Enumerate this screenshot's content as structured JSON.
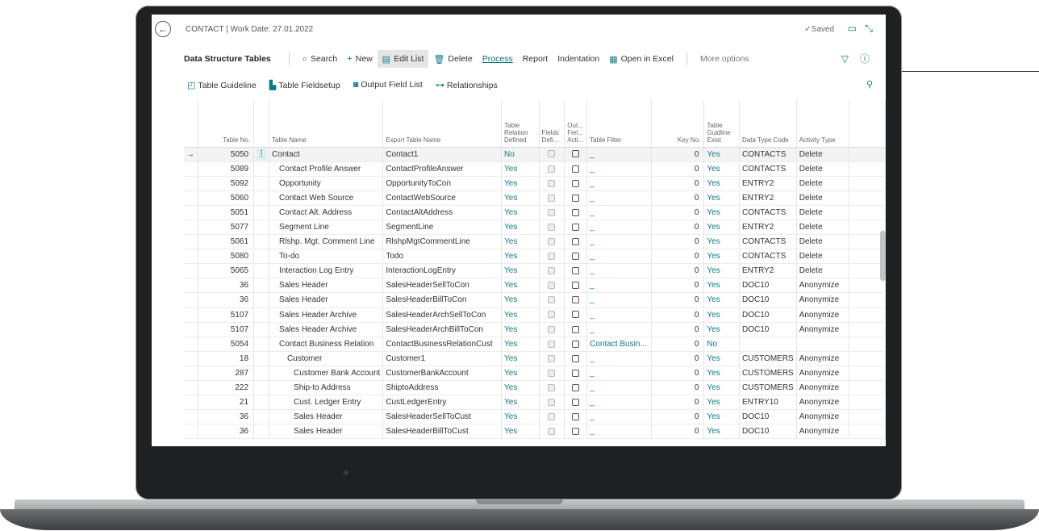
{
  "header": {
    "caption": "CONTACT | Work Date: 27.01.2022",
    "saved": "✓Saved",
    "back_icon": "←"
  },
  "action_bar": {
    "title": "Data Structure Tables",
    "search": "Search",
    "new": "New",
    "edit_list": "Edit List",
    "delete": "Delete",
    "process": "Process",
    "report": "Report",
    "indentation": "Indentation",
    "open_in_excel": "Open in Excel",
    "more_options": "More options"
  },
  "sub_bar": {
    "table_guideline": "Table Guideline",
    "table_fieldsetup": "Table Fieldsetup",
    "output_field_list": "Output Field List",
    "relationships": "Relationships"
  },
  "columns": {
    "table_no": "Table No.",
    "table_name": "Table Name",
    "export_table_name": "Export Table Name",
    "table_relation_defined": "Table Relation Defined",
    "fields_defined": "Fields Defi...",
    "output_fields_active": "Out... Fiel... Acti...",
    "table_filter": "Table Filter",
    "key_no": "Key No.",
    "table_guideline_exist": "Table Guidline Exist",
    "data_type_code": "Data Type Code",
    "activity_type": "Activity Type"
  },
  "rows": [
    {
      "no": "5050",
      "name": "Contact",
      "indent": 0,
      "export": "Contact1",
      "rel": "No",
      "filter": "_",
      "key": "0",
      "guide": "Yes",
      "dtype": "CONTACTS",
      "activity": "Delete"
    },
    {
      "no": "5089",
      "name": "Contact Profile Answer",
      "indent": 1,
      "export": "ContactProfileAnswer",
      "rel": "Yes",
      "filter": "_",
      "key": "0",
      "guide": "Yes",
      "dtype": "CONTACTS",
      "activity": "Delete"
    },
    {
      "no": "5092",
      "name": "Opportunity",
      "indent": 1,
      "export": "OpportunityToCon",
      "rel": "Yes",
      "filter": "_",
      "key": "0",
      "guide": "Yes",
      "dtype": "ENTRY2",
      "activity": "Delete"
    },
    {
      "no": "5060",
      "name": "Contact Web Source",
      "indent": 1,
      "export": "ContactWebSource",
      "rel": "Yes",
      "filter": "_",
      "key": "0",
      "guide": "Yes",
      "dtype": "ENTRY2",
      "activity": "Delete"
    },
    {
      "no": "5051",
      "name": "Contact Alt. Address",
      "indent": 1,
      "export": "ContactAltAddress",
      "rel": "Yes",
      "filter": "_",
      "key": "0",
      "guide": "Yes",
      "dtype": "CONTACTS",
      "activity": "Delete"
    },
    {
      "no": "5077",
      "name": "Segment Line",
      "indent": 1,
      "export": "SegmentLine",
      "rel": "Yes",
      "filter": "_",
      "key": "0",
      "guide": "Yes",
      "dtype": "ENTRY2",
      "activity": "Delete"
    },
    {
      "no": "5061",
      "name": "Rlshp. Mgt. Comment Line",
      "indent": 1,
      "export": "RlshpMgtCommentLine",
      "rel": "Yes",
      "filter": "_",
      "key": "0",
      "guide": "Yes",
      "dtype": "CONTACTS",
      "activity": "Delete"
    },
    {
      "no": "5080",
      "name": "To-do",
      "indent": 1,
      "export": "Todo",
      "rel": "Yes",
      "filter": "_",
      "key": "0",
      "guide": "Yes",
      "dtype": "CONTACTS",
      "activity": "Delete"
    },
    {
      "no": "5065",
      "name": "Interaction Log Entry",
      "indent": 1,
      "export": "InteractionLogEntry",
      "rel": "Yes",
      "filter": "_",
      "key": "0",
      "guide": "Yes",
      "dtype": "ENTRY2",
      "activity": "Delete"
    },
    {
      "no": "36",
      "name": "Sales Header",
      "indent": 1,
      "export": "SalesHeaderSellToCon",
      "rel": "Yes",
      "filter": "_",
      "key": "0",
      "guide": "Yes",
      "dtype": "DOC10",
      "activity": "Anonymize"
    },
    {
      "no": "36",
      "name": "Sales Header",
      "indent": 1,
      "export": "SalesHeaderBillToCon",
      "rel": "Yes",
      "filter": "_",
      "key": "0",
      "guide": "Yes",
      "dtype": "DOC10",
      "activity": "Anonymize"
    },
    {
      "no": "5107",
      "name": "Sales Header Archive",
      "indent": 1,
      "export": "SalesHeaderArchSellToCon",
      "rel": "Yes",
      "filter": "_",
      "key": "0",
      "guide": "Yes",
      "dtype": "DOC10",
      "activity": "Anonymize"
    },
    {
      "no": "5107",
      "name": "Sales Header Archive",
      "indent": 1,
      "export": "SalesHeaderArchBillToCon",
      "rel": "Yes",
      "filter": "_",
      "key": "0",
      "guide": "Yes",
      "dtype": "DOC10",
      "activity": "Anonymize"
    },
    {
      "no": "5054",
      "name": "Contact Business Relation",
      "indent": 1,
      "export": "ContactBusinessRelationCust",
      "rel": "Yes",
      "filter": "Contact Busin...",
      "key": "0",
      "guide": "No",
      "dtype": "",
      "activity": ""
    },
    {
      "no": "18",
      "name": "Customer",
      "indent": 2,
      "export": "Customer1",
      "rel": "Yes",
      "filter": "_",
      "key": "0",
      "guide": "Yes",
      "dtype": "CUSTOMERS",
      "activity": "Anonymize"
    },
    {
      "no": "287",
      "name": "Customer Bank Account",
      "indent": 3,
      "export": "CustomerBankAccount",
      "rel": "Yes",
      "filter": "_",
      "key": "0",
      "guide": "Yes",
      "dtype": "CUSTOMERS",
      "activity": "Anonymize"
    },
    {
      "no": "222",
      "name": "Ship-to Address",
      "indent": 3,
      "export": "ShiptoAddress",
      "rel": "Yes",
      "filter": "_",
      "key": "0",
      "guide": "Yes",
      "dtype": "CUSTOMERS",
      "activity": "Anonymize"
    },
    {
      "no": "21",
      "name": "Cust. Ledger Entry",
      "indent": 3,
      "export": "CustLedgerEntry",
      "rel": "Yes",
      "filter": "_",
      "key": "0",
      "guide": "Yes",
      "dtype": "ENTRY10",
      "activity": "Anonymize"
    },
    {
      "no": "36",
      "name": "Sales Header",
      "indent": 3,
      "export": "SalesHeaderSellToCust",
      "rel": "Yes",
      "filter": "_",
      "key": "0",
      "guide": "Yes",
      "dtype": "DOC10",
      "activity": "Anonymize"
    },
    {
      "no": "36",
      "name": "Sales Header",
      "indent": 3,
      "export": "SalesHeaderBillToCust",
      "rel": "Yes",
      "filter": "_",
      "key": "0",
      "guide": "Yes",
      "dtype": "DOC10",
      "activity": "Anonymize"
    }
  ],
  "colors": {
    "accent": "#0b7a86",
    "laptop_frame": "#1f2022"
  }
}
